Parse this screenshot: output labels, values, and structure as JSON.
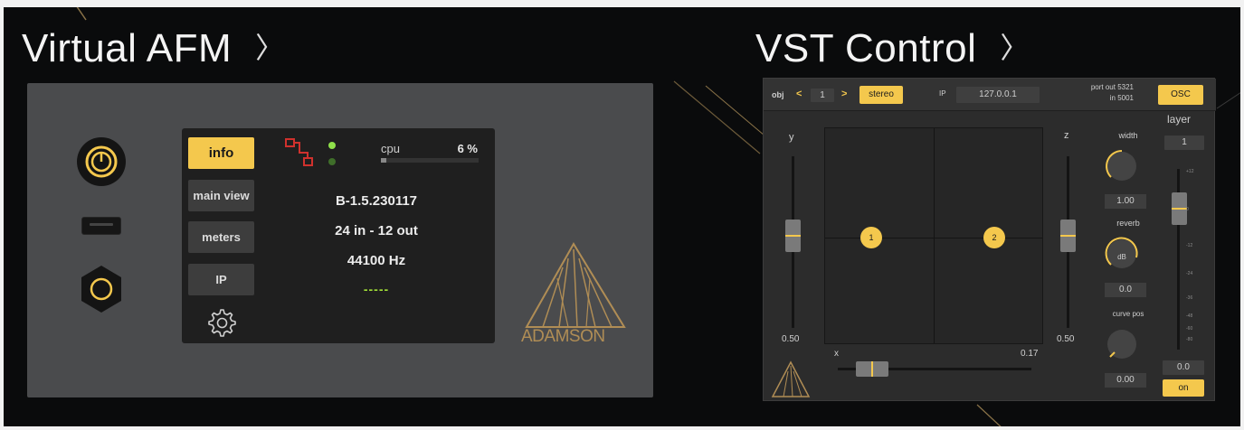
{
  "headings": {
    "left": "Virtual AFM",
    "right": "VST Control",
    "chevron": "〉"
  },
  "afm": {
    "tabs": [
      {
        "label": "info",
        "active": true
      },
      {
        "label": "main view",
        "active": false
      },
      {
        "label": "meters",
        "active": false
      },
      {
        "label": "IP",
        "active": false
      }
    ],
    "cpu_label": "cpu",
    "cpu_value": "6 %",
    "cpu_fraction": 0.06,
    "version": "B-1.5.230117",
    "io": "24 in - 12 out",
    "samplerate": "44100 Hz",
    "status_dashes": "-----",
    "logo_text": "ADAMSON",
    "colors": {
      "accent": "#f4c84d",
      "logo": "#b08d55",
      "led_on": "#8fe04a",
      "led_dim": "#3f6e2a",
      "network_icon": "#d0312d"
    },
    "icons": [
      "power-icon",
      "usb-port",
      "hex-button",
      "settings-gear-icon",
      "network-icon"
    ]
  },
  "vst": {
    "obj_label": "obj",
    "obj_prev": "<",
    "obj_value": "1",
    "obj_next": ">",
    "stereo_label": "stereo",
    "ip_label": "IP",
    "ip_value": "127.0.0.1",
    "port_out": "port out 5321",
    "port_in": "in 5001",
    "osc_label": "OSC",
    "y_label": "y",
    "y_value": "0.50",
    "x_label": "x",
    "x_value": "0.17",
    "z_label": "z",
    "z_value": "0.50",
    "objects": [
      "1",
      "2"
    ],
    "width_label": "width",
    "width_value": "1.00",
    "reverb_label": "reverb",
    "reverb_knob_text": "dB",
    "reverb_value": "0.0",
    "curve_label": "curve pos",
    "curve_value": "0.00",
    "layer_label": "layer",
    "layer_value": "1",
    "layer_gain": "0.0",
    "on_label": "on",
    "meter_ticks": [
      "+12",
      "0",
      "-12",
      "-24",
      "-36",
      "-48",
      "-60",
      "-80"
    ]
  }
}
